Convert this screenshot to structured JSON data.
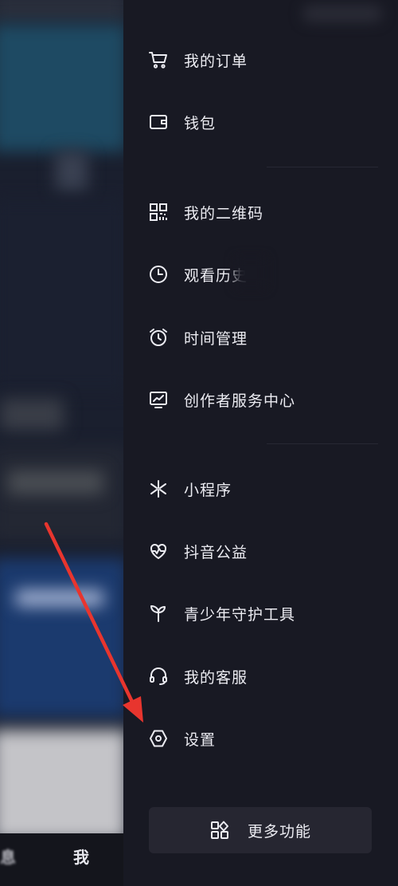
{
  "drawer": {
    "items": [
      {
        "label": "我的订单",
        "icon": "cart-icon"
      },
      {
        "label": "钱包",
        "icon": "wallet-icon"
      },
      {
        "label": "我的二维码",
        "icon": "qr-code-icon"
      },
      {
        "label": "观看历史",
        "icon": "clock-icon"
      },
      {
        "label": "时间管理",
        "icon": "alarm-clock-icon"
      },
      {
        "label": "创作者服务中心",
        "icon": "monitor-chart-icon"
      },
      {
        "label": "小程序",
        "icon": "mini-program-icon"
      },
      {
        "label": "抖音公益",
        "icon": "charity-heart-icon"
      },
      {
        "label": "青少年守护工具",
        "icon": "sprout-icon"
      },
      {
        "label": "我的客服",
        "icon": "headset-icon"
      },
      {
        "label": "设置",
        "icon": "settings-hexagon-icon"
      }
    ],
    "more": {
      "label": "更多功能",
      "icon": "grid-icon"
    }
  },
  "bottom_nav": {
    "messages_label": "消息",
    "messages_visible": "息",
    "me_label": "我"
  },
  "annotation": {
    "color": "#e8352e",
    "target": "设置"
  },
  "colors": {
    "drawer_bg": "#181923",
    "text": "#ececf2",
    "button_bg": "#262631"
  }
}
